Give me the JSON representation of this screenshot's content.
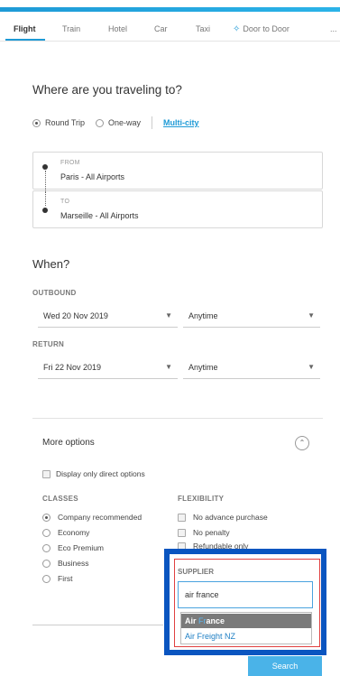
{
  "tabs": [
    {
      "label": "Flight"
    },
    {
      "label": "Train"
    },
    {
      "label": "Hotel"
    },
    {
      "label": "Car"
    },
    {
      "label": "Taxi"
    },
    {
      "label": "Door to Door"
    }
  ],
  "tabs_overflow": "...",
  "accent_color": "#1e9ad6",
  "heading_travel": "Where are you traveling to?",
  "trip_type": {
    "round_trip": "Round Trip",
    "one_way": "One-way",
    "multi_city": "Multi-city",
    "selected": "Round Trip"
  },
  "from": {
    "label": "FROM",
    "value": "Paris - All Airports"
  },
  "to": {
    "label": "TO",
    "value": "Marseille - All Airports"
  },
  "heading_when": "When?",
  "outbound": {
    "label": "OUTBOUND",
    "date": "Wed 20 Nov 2019",
    "time": "Anytime"
  },
  "return": {
    "label": "RETURN",
    "date": "Fri 22 Nov 2019",
    "time": "Anytime"
  },
  "more_options": {
    "title": "More options",
    "direct_only": "Display only direct options",
    "classes_label": "CLASSES",
    "classes": [
      "Company recommended",
      "Economy",
      "Eco Premium",
      "Business",
      "First"
    ],
    "flexibility_label": "FLEXIBILITY",
    "flexibility": [
      "No advance purchase",
      "No penalty",
      "Refundable only"
    ]
  },
  "supplier": {
    "label": "SUPPLIER",
    "input_value": "air france",
    "suggestions": [
      {
        "prefix": "Air ",
        "match": "Fr",
        "suffix": "ance",
        "full": "Air France"
      },
      {
        "full": "Air Freight NZ"
      }
    ]
  },
  "search_button": "Search"
}
